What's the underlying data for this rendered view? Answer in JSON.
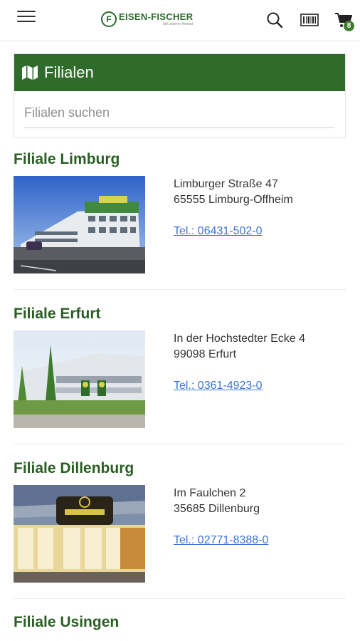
{
  "header": {
    "logo_name": "EISEN-FISCHER",
    "logo_tagline": "tief unserer Heimat",
    "cart_count": "8",
    "icons": [
      "menu-icon",
      "search-icon",
      "barcode-icon",
      "cart-icon"
    ]
  },
  "panel": {
    "title": "Filialen",
    "search_placeholder": "Filialen suchen"
  },
  "branches": [
    {
      "name": "Filiale Limburg",
      "street": "Limburger Straße 47",
      "city": "65555 Limburg-Offheim",
      "phone": "Tel.: 06431-502-0"
    },
    {
      "name": "Filiale Erfurt",
      "street": "In der Hochstedter Ecke 4",
      "city": "99098 Erfurt",
      "phone": "Tel.: 0361-4923-0"
    },
    {
      "name": "Filiale Dillenburg",
      "street": "Im Faulchen 2",
      "city": "35685 Dillenburg",
      "phone": "Tel.: 02771-8388-0"
    },
    {
      "name": "Filiale Usingen"
    }
  ],
  "colors": {
    "brand_green": "#2f6b2b",
    "link_blue": "#3b73d6",
    "badge_green": "#3f7c2e"
  }
}
